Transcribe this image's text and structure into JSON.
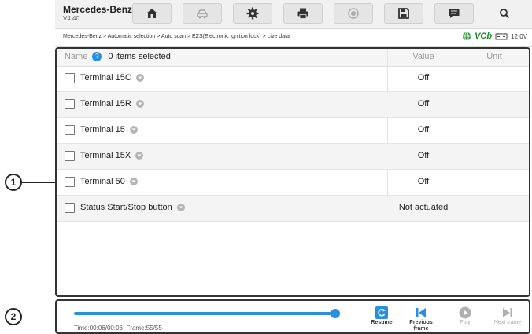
{
  "app": {
    "brand": "Mercedes-Benz",
    "version": "V4.40"
  },
  "toolbar": {
    "buttons": [
      {
        "name": "home-button",
        "icon": "home-icon"
      },
      {
        "name": "vehicle-swap-button",
        "icon": "car-swap-icon"
      },
      {
        "name": "settings-button",
        "icon": "gear-icon"
      },
      {
        "name": "print-button",
        "icon": "printer-icon"
      },
      {
        "name": "help-button",
        "icon": "record-icon"
      },
      {
        "name": "save-button",
        "icon": "save-icon"
      },
      {
        "name": "message-button",
        "icon": "message-icon"
      },
      {
        "name": "search-button",
        "icon": "search-icon"
      }
    ]
  },
  "breadcrumb": "Mercedes-Benz > Automatic selection > Auto scan > EZS(Electronic ignition lock) > Live data",
  "status": {
    "vci": "VCb",
    "voltage": "12.0V"
  },
  "table": {
    "header": {
      "name": "Name",
      "selected": "0 items selected",
      "value": "Value",
      "unit": "Unit"
    },
    "rows": [
      {
        "name": "Terminal 15C",
        "value": "Off",
        "unit": ""
      },
      {
        "name": "Terminal 15R",
        "value": "Off",
        "unit": ""
      },
      {
        "name": "Terminal 15",
        "value": "Off",
        "unit": ""
      },
      {
        "name": "Terminal 15X",
        "value": "Off",
        "unit": ""
      },
      {
        "name": "Terminal 50",
        "value": "Off",
        "unit": ""
      },
      {
        "name": "Status Start/Stop button",
        "value": "Not actuated",
        "unit": ""
      }
    ]
  },
  "playback": {
    "time": "Time:00:06/00:06",
    "frame": "Frame:55/55",
    "progress": 1.0,
    "controls": [
      {
        "label": "Resume",
        "enabled": true
      },
      {
        "label": "Previous frame",
        "enabled": true
      },
      {
        "label": "Play",
        "enabled": false
      },
      {
        "label": "Next frame",
        "enabled": false
      }
    ]
  },
  "callouts": [
    "1",
    "2"
  ],
  "colors": {
    "accent": "#2a8fe0",
    "vci": "#1a8a2a",
    "disabled": "#aaaaaa"
  }
}
